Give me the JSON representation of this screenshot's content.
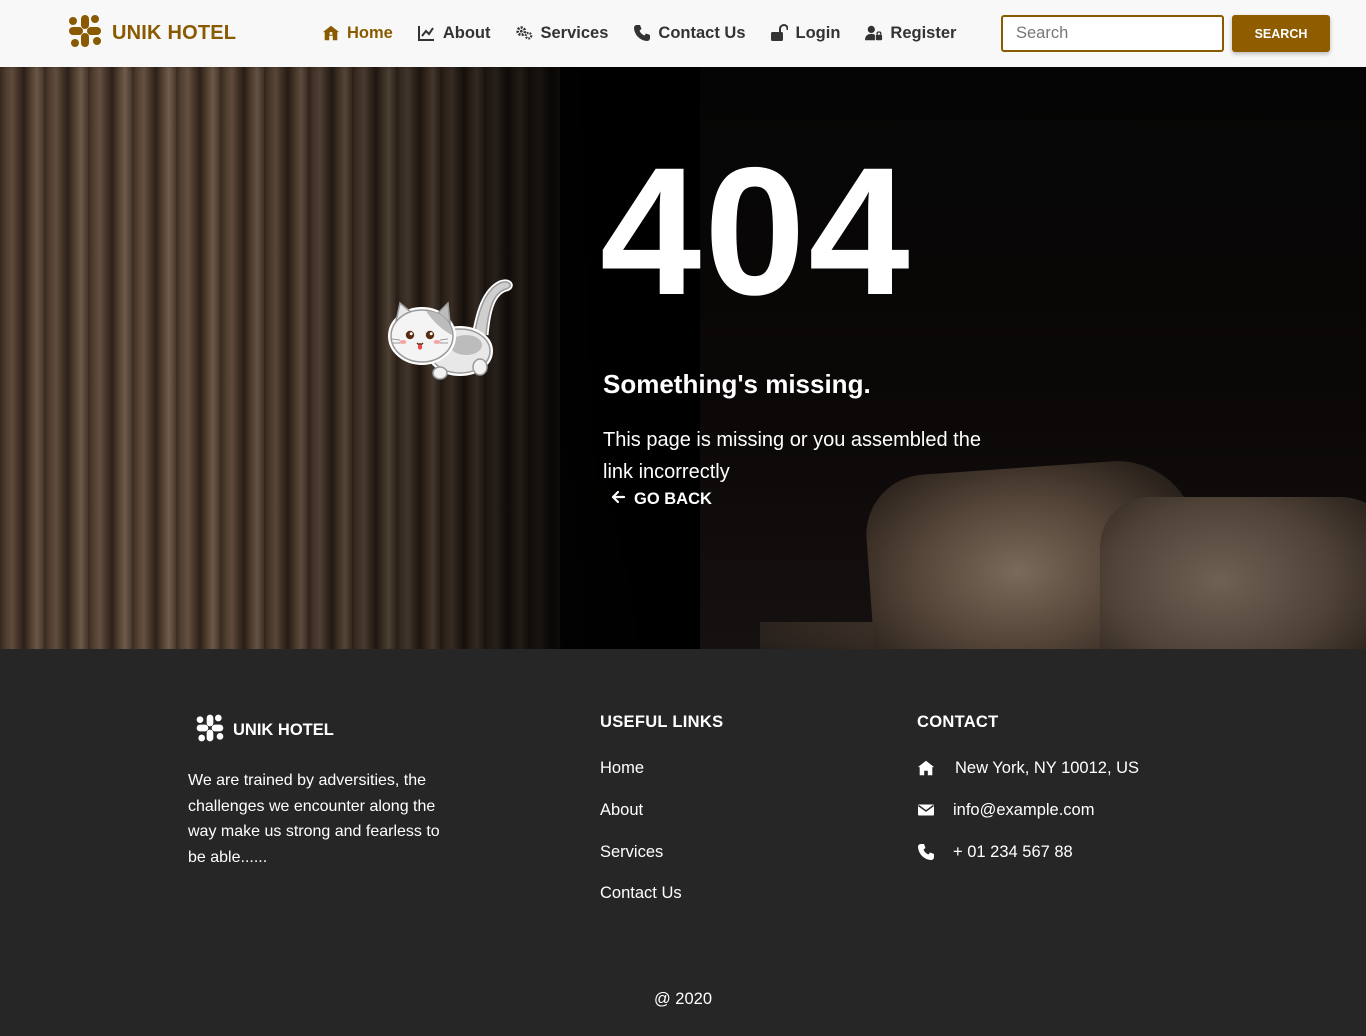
{
  "colors": {
    "brand": "#8a5a00",
    "footer_bg": "#262626",
    "nav_bg": "#f8f8f8"
  },
  "navbar": {
    "brand": {
      "name": "UNIK HOTEL",
      "icon": "slack-like-logo-icon"
    },
    "items": [
      {
        "label": "Home",
        "icon": "home-icon",
        "active": true
      },
      {
        "label": "About",
        "icon": "chart-line-icon",
        "active": false
      },
      {
        "label": "Services",
        "icon": "gears-icon",
        "active": false
      },
      {
        "label": "Contact Us",
        "icon": "phone-icon",
        "active": false
      },
      {
        "label": "Login",
        "icon": "unlock-icon",
        "active": false
      },
      {
        "label": "Register",
        "icon": "user-lock-icon",
        "active": false
      }
    ],
    "search": {
      "placeholder": "Search",
      "value": "",
      "button_label": "SEARCH"
    }
  },
  "hero": {
    "code": "404",
    "title": "Something's missing.",
    "description": "This page is missing or you assembled the link incorrectly",
    "back_label": "GO BACK",
    "illustration": "cat-illustration"
  },
  "footer": {
    "brand": {
      "name": "UNIK HOTEL",
      "icon": "slack-like-logo-icon"
    },
    "about": "We are trained by adversities, the challenges we encounter along the way make us strong and fearless to be able......",
    "useful_links": {
      "heading": "USEFUL LINKS",
      "items": [
        "Home",
        "About",
        "Services",
        "Contact Us"
      ]
    },
    "contact": {
      "heading": "CONTACT",
      "address": "New York, NY 10012, US",
      "email": "info@example.com",
      "phone": "+ 01 234 567 88"
    },
    "copyright": "@ 2020"
  }
}
